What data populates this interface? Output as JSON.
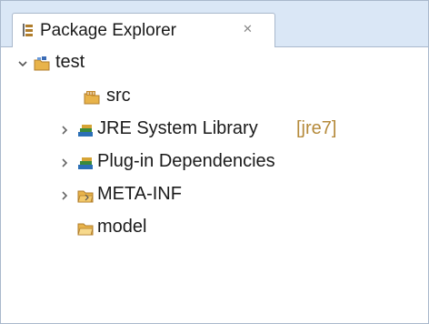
{
  "view": {
    "title": "Package Explorer",
    "close_glyph": "✕",
    "tab_icon": "package-explorer-icon",
    "close_icon": "close-icon"
  },
  "tree": {
    "project": {
      "label": "test",
      "icon": "java-project-icon",
      "expanded": true,
      "children": {
        "src": {
          "label": "src",
          "icon": "source-folder-icon"
        },
        "jre": {
          "label": "JRE System Library",
          "decoration": "[jre7]",
          "icon": "library-icon",
          "expanded": false
        },
        "plugin": {
          "label": "Plug-in Dependencies",
          "icon": "library-icon",
          "expanded": false
        },
        "metainf": {
          "label": "META-INF",
          "icon": "folder-icon",
          "expanded": false
        },
        "model": {
          "label": "model",
          "icon": "folder-icon"
        }
      }
    }
  },
  "colors": {
    "tab_strip": "#dae7f6",
    "border": "#a9b8cc",
    "decoration_text": "#b58a3b",
    "folder": "#e8b34a",
    "library_book": "#2b6fb6"
  }
}
